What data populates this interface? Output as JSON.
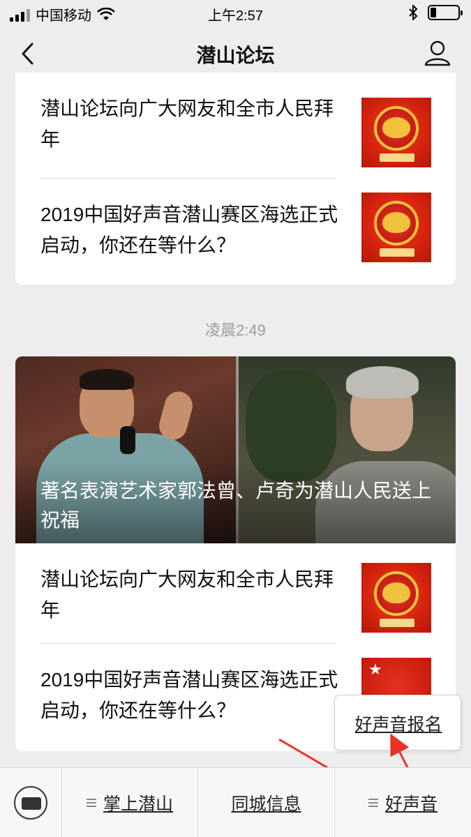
{
  "status_bar": {
    "carrier": "中国移动",
    "time": "上午2:57",
    "wifi_icon": "wifi-icon",
    "bluetooth_icon": "bluetooth-icon",
    "battery_level": 0.2
  },
  "nav": {
    "title": "潜山论坛",
    "back_icon": "chevron-left-icon",
    "profile_icon": "user-icon"
  },
  "feed": {
    "group1": {
      "items": [
        {
          "title": "潜山论坛向广大网友和全市人民拜年",
          "thumb": "new-year-pig-thumbnail"
        },
        {
          "title": "2019中国好声音潜山赛区海选正式启动，你还在等什么？",
          "thumb": "new-year-pig-thumbnail"
        }
      ]
    },
    "timestamp": "凌晨2:49",
    "group2": {
      "hero_title": "著名表演艺术家郭法曾、卢奇为潜山人民送上祝福",
      "items": [
        {
          "title": "潜山论坛向广大网友和全市人民拜年",
          "thumb": "new-year-pig-thumbnail"
        },
        {
          "title": "2019中国好声音潜山赛区海选正式启动，你还在等什么？",
          "thumb": "voice-of-china-thumbnail"
        }
      ]
    }
  },
  "popup": {
    "items": [
      "好声音报名"
    ]
  },
  "bottom_menu": {
    "keyboard_icon": "keyboard-icon",
    "items": [
      {
        "label": "掌上潜山",
        "has_submenu": true
      },
      {
        "label": "同城信息",
        "has_submenu": false
      },
      {
        "label": "好声音",
        "has_submenu": true
      }
    ]
  },
  "colors": {
    "background": "#ededed",
    "card": "#ffffff",
    "timestamp": "#9b9b9b",
    "annotation_arrow": "#e8322a"
  }
}
